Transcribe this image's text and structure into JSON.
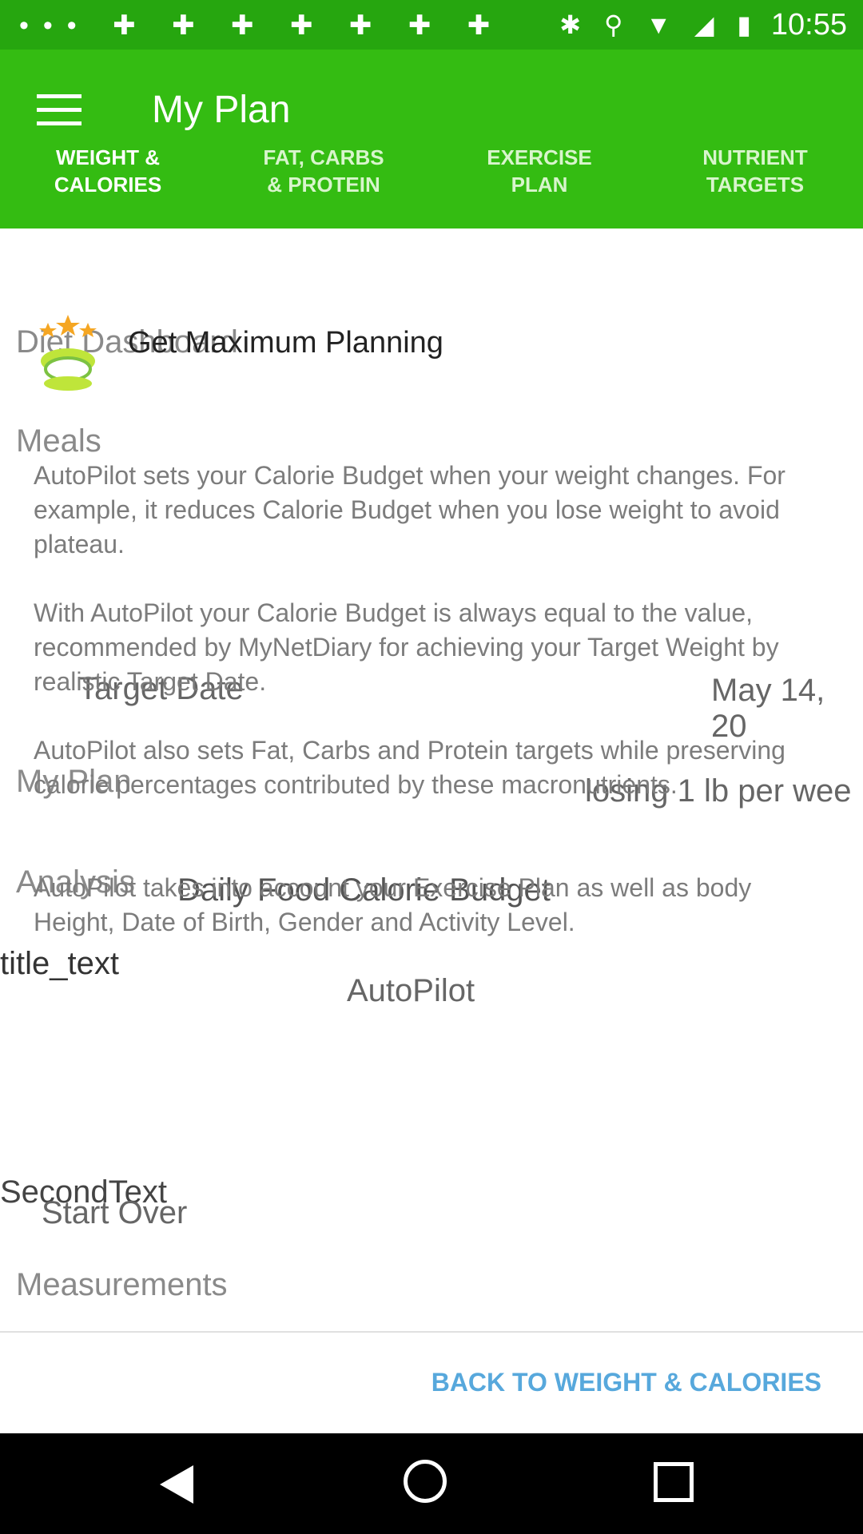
{
  "status_bar": {
    "time": "10:55",
    "left_icons": "•••  ✚ ✚ ✚ ✚ ✚ ✚ ✚",
    "right_icons": "✱ ⚲ ▼ ◢ ▮"
  },
  "app_bar": {
    "title": "My Plan",
    "menu_icon": "hamburger-menu-icon"
  },
  "tabs": [
    {
      "line1": "WEIGHT &",
      "line2": "CALORIES"
    },
    {
      "line1": "FAT, CARBS",
      "line2": "& PROTEIN"
    },
    {
      "line1": "EXERCISE",
      "line2": "PLAN"
    },
    {
      "line1": "NUTRIENT",
      "line2": "TARGETS"
    }
  ],
  "underlay": {
    "diet_dashboard": "Diet Dashboard",
    "meals": "Meals",
    "target_date_label": "Target Date",
    "target_date_value": "May 14, 20",
    "my_plan": "My Plan",
    "my_plan_value": "losing 1 lb per wee",
    "analysis": "Analysis",
    "daily_budget": "Daily Food Calorie Budget",
    "title_text": "title_text",
    "autopilot": "AutoPilot",
    "second_text": "SecondText",
    "start_over": "Start Over",
    "measurements": "Measurements"
  },
  "dialog": {
    "title": "Get Maximum Planning",
    "paragraphs": [
      "AutoPilot sets your Calorie Budget when your weight changes. For example, it reduces Calorie Budget when you lose weight to avoid plateau.",
      "With AutoPilot your Calorie Budget is always equal to the value, recommended by MyNetDiary for achieving your Target Weight by realistic Target Date.",
      "AutoPilot also sets Fat, Carbs and Protein targets while preserving calorie percentages contributed by these macronutrients.",
      "AutoPilot takes into account your Exercise Plan as well as body Height, Date of Birth, Gender and Activity Level."
    ],
    "back_button": "BACK TO WEIGHT & CALORIES"
  },
  "colors": {
    "app_bar": "#34bc12",
    "status_bar": "#26a60f",
    "link": "#57a8dc"
  }
}
